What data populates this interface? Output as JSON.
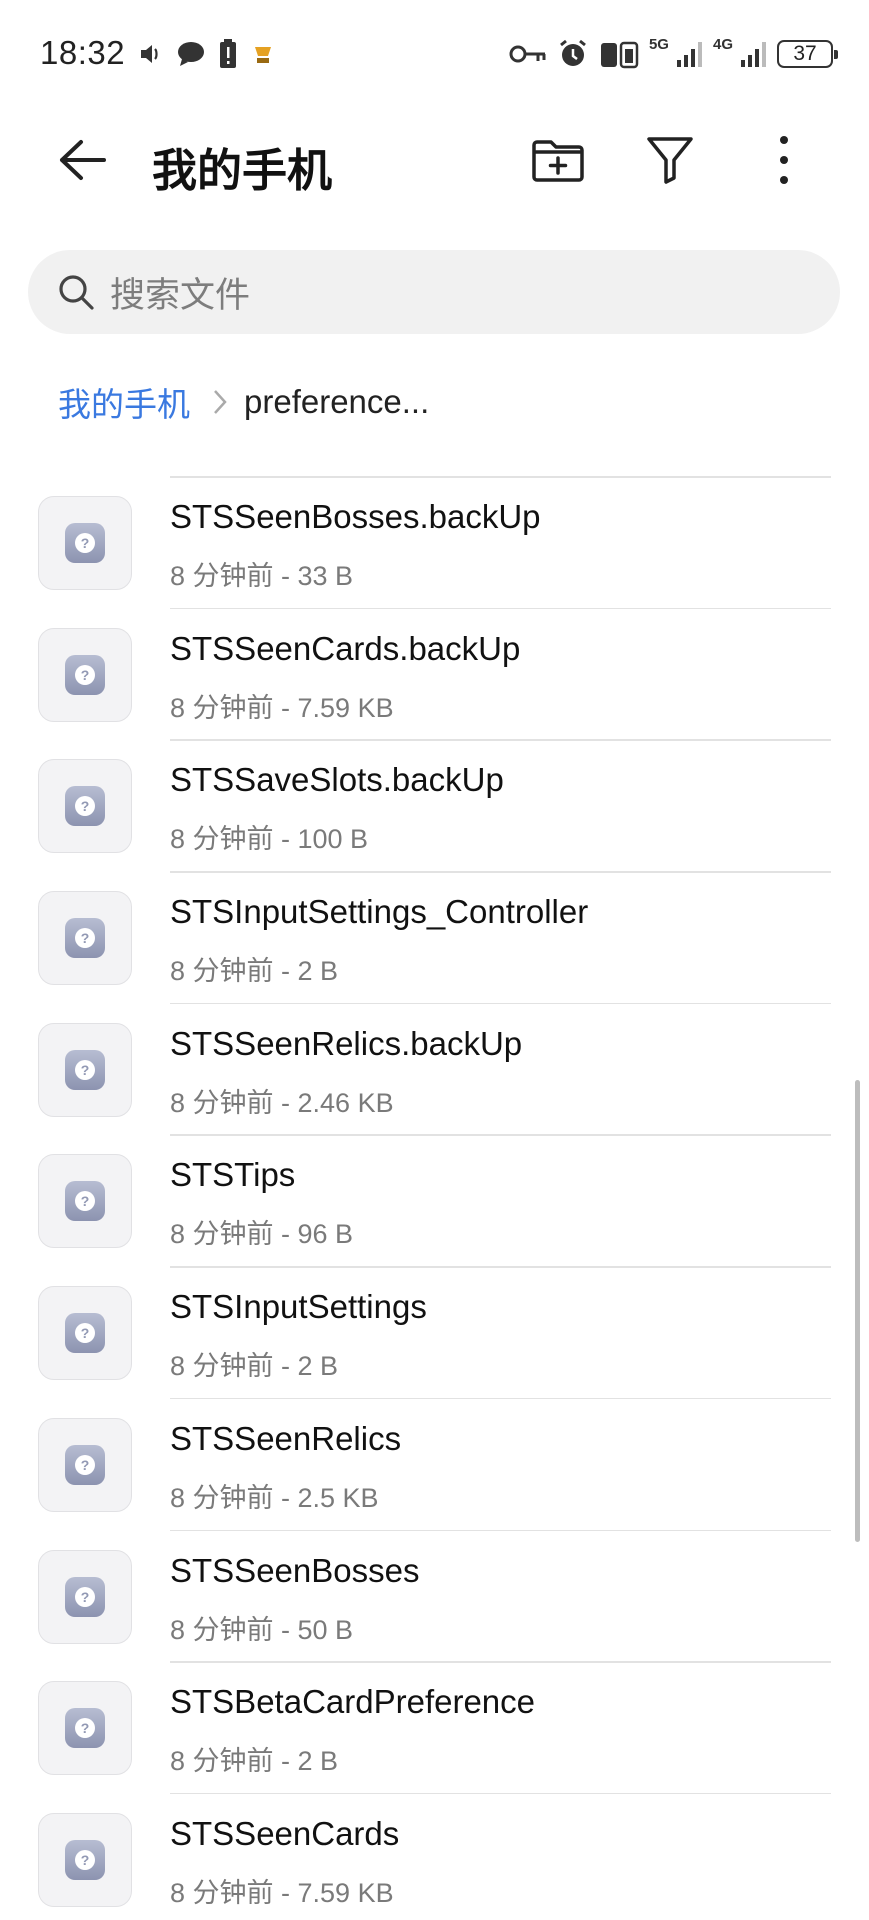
{
  "status_bar": {
    "time": "18:32",
    "network_5g": "5G",
    "network_4g": "4G",
    "battery": "37"
  },
  "header": {
    "title": "我的手机"
  },
  "search": {
    "placeholder": "搜索文件"
  },
  "breadcrumb": {
    "root": "我的手机",
    "current": "preference..."
  },
  "files": [
    {
      "name": "STSSeenBosses.backUp",
      "meta": "8 分钟前 - 33 B"
    },
    {
      "name": "STSSeenCards.backUp",
      "meta": "8 分钟前 - 7.59 KB"
    },
    {
      "name": "STSSaveSlots.backUp",
      "meta": "8 分钟前 - 100 B"
    },
    {
      "name": "STSInputSettings_Controller",
      "meta": "8 分钟前 - 2 B"
    },
    {
      "name": "STSSeenRelics.backUp",
      "meta": "8 分钟前 - 2.46 KB"
    },
    {
      "name": "STSTips",
      "meta": "8 分钟前 - 96 B"
    },
    {
      "name": "STSInputSettings",
      "meta": "8 分钟前 - 2 B"
    },
    {
      "name": "STSSeenRelics",
      "meta": "8 分钟前 - 2.5 KB"
    },
    {
      "name": "STSSeenBosses",
      "meta": "8 分钟前 - 50 B"
    },
    {
      "name": "STSBetaCardPreference",
      "meta": "8 分钟前 - 2 B"
    },
    {
      "name": "STSSeenCards",
      "meta": "8 分钟前 - 7.59 KB"
    }
  ],
  "colors": {
    "accent": "#3a79e0",
    "search_bg": "#f1f1f1",
    "file_icon": "#8c93b0"
  },
  "icons": {
    "back": "arrow-left-icon",
    "new_folder": "folder-plus-icon",
    "filter": "filter-funnel-icon",
    "more": "more-vertical-icon",
    "search": "search-icon",
    "unknown_file": "unknown-file-icon"
  }
}
